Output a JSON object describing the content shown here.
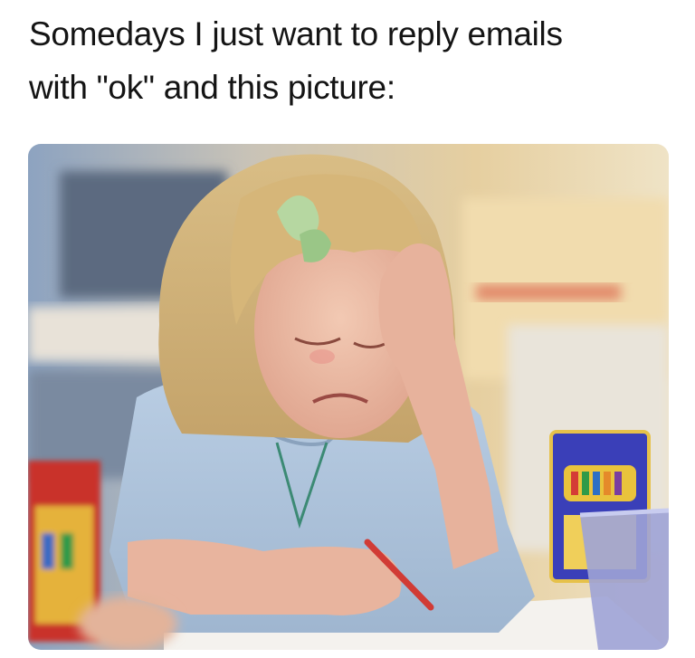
{
  "caption": {
    "line1": "Somedays I just want to reply emails",
    "line2": "with \"ok\" and this picture:"
  },
  "photo": {
    "subject": "crying-girl-drawing-with-crayon",
    "box_label": "CRAYONS"
  }
}
